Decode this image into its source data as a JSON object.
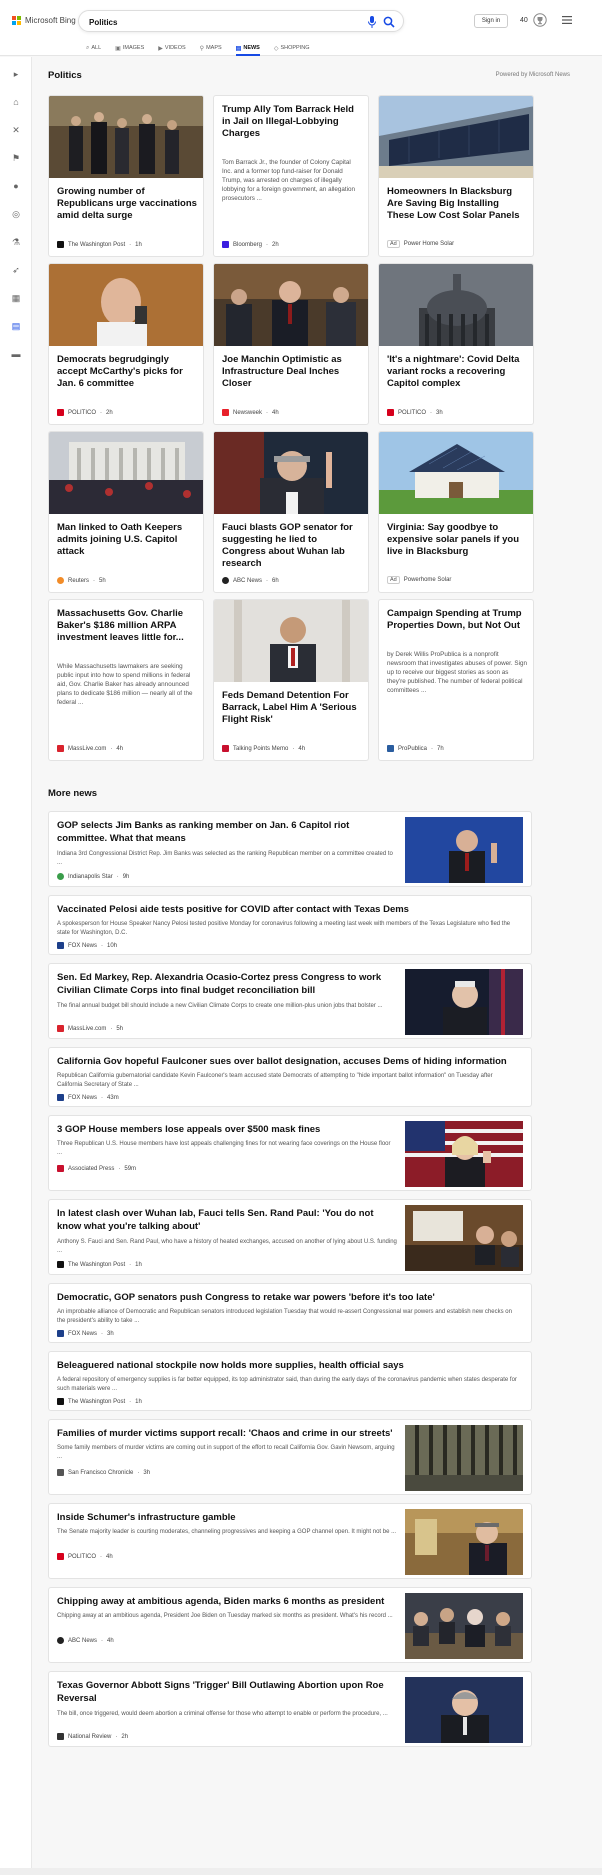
{
  "header": {
    "logo_text": "Microsoft Bing",
    "search_value": "Politics",
    "signin_label": "Sign in",
    "rewards_count": "40",
    "accent": "#174ae4"
  },
  "tabs": [
    {
      "label": "ALL",
      "icon": "search-icon"
    },
    {
      "label": "IMAGES",
      "icon": "image-icon"
    },
    {
      "label": "VIDEOS",
      "icon": "video-icon"
    },
    {
      "label": "MAPS",
      "icon": "map-pin-icon"
    },
    {
      "label": "NEWS",
      "icon": "news-icon",
      "active": true
    },
    {
      "label": "SHOPPING",
      "icon": "tag-icon"
    }
  ],
  "rail_icons": [
    "expand-icon",
    "home-icon",
    "tools-icon",
    "flag-icon",
    "location-icon",
    "globe-icon",
    "science-icon",
    "rocket-icon",
    "video-icon",
    "news-icon",
    "card-icon"
  ],
  "section": {
    "title": "Politics",
    "powered_by": "Powered by Microsoft News"
  },
  "cards": [
    {
      "title": "Growing number of Republicans urge vaccinations amid delta surge",
      "source": "The Washington Post",
      "time": "1h",
      "favicon_color": "#111"
    },
    {
      "title": "Trump Ally Tom Barrack Held in Jail on Illegal-Lobbying Charges",
      "snippet": "Tom Barrack Jr., the founder of Colony Capital Inc. and a former top fund-raiser for Donald Trump, was arrested on charges of illegally lobbying for a foreign government, an allegation prosecutors ...",
      "source": "Bloomberg",
      "time": "2h",
      "favicon_color": "#3b1ee0"
    },
    {
      "title": "Homeowners In Blacksburg Are Saving Big Installing These Low Cost Solar Panels",
      "source": "Power Home Solar",
      "ad": "Ad"
    },
    {
      "title": "Democrats begrudgingly accept McCarthy's picks for Jan. 6 committee",
      "source": "POLITICO",
      "time": "2h",
      "favicon_color": "#d6001c"
    },
    {
      "title": "Joe Manchin Optimistic as Infrastructure Deal Inches Closer",
      "source": "Newsweek",
      "time": "4h",
      "favicon_color": "#e8202a"
    },
    {
      "title": "'It's a nightmare': Covid Delta variant rocks a recovering Capitol complex",
      "source": "POLITICO",
      "time": "3h",
      "favicon_color": "#d6001c"
    },
    {
      "title": "Man linked to Oath Keepers admits joining U.S. Capitol attack",
      "source": "Reuters",
      "time": "5h",
      "favicon_color": "#f28c28"
    },
    {
      "title": "Fauci blasts GOP senator for suggesting he lied to Congress about Wuhan lab research",
      "source": "ABC News",
      "time": "6h",
      "favicon_color": "#222"
    },
    {
      "title": "Virginia: Say goodbye to expensive solar panels if you live in Blacksburg",
      "source": "Powerhome Solar",
      "ad": "Ad"
    },
    {
      "title": "Massachusetts Gov. Charlie Baker's $186 million ARPA investment leaves little for...",
      "snippet": "While Massachusetts lawmakers are seeking public input into how to spend millions in federal aid, Gov. Charlie Baker has already announced plans to dedicate $186 million — nearly all of the federal ...",
      "source": "MassLive.com",
      "time": "4h",
      "favicon_color": "#d9232d"
    },
    {
      "title": "Feds Demand Detention For Barrack, Label Him A 'Serious Flight Risk'",
      "source": "Talking Points Memo",
      "time": "4h",
      "favicon_color": "#c8102e"
    },
    {
      "title": "Campaign Spending at Trump Properties Down, but Not Out",
      "snippet": "by Derek Willis ProPublica is a nonprofit newsroom that investigates abuses of power. Sign up to receive our biggest stories as soon as they're published. The number of federal political committees ...",
      "source": "ProPublica",
      "time": "7h",
      "favicon_color": "#2a5d9f"
    }
  ],
  "more_news": {
    "title": "More news",
    "items": [
      {
        "title": "GOP selects Jim Banks as ranking member on Jan. 6 Capitol riot committee. What that means",
        "snippet": "Indiana 3rd Congressional District Rep. Jim Banks was selected as the ranking Republican member on a committee created to ...",
        "source": "Indianapolis Star",
        "time": "9h",
        "favicon_color": "#3a9d4a"
      },
      {
        "title": "Vaccinated Pelosi aide tests positive for COVID after contact with Texas Dems",
        "snippet": "A spokesperson for House Speaker Nancy Pelosi tested positive Monday for coronavirus following a meeting last week with members of the Texas Legislature who fled the state for Washington, D.C.",
        "source": "FOX News",
        "time": "10h",
        "favicon_color": "#1d3f8a"
      },
      {
        "title": "Sen. Ed Markey, Rep. Alexandria Ocasio-Cortez press Congress to work Civilian Climate Corps into final budget reconciliation bill",
        "snippet": "The final annual budget bill should include a new Civilian Climate Corps to create one million-plus union jobs that bolster ...",
        "source": "MassLive.com",
        "time": "5h",
        "favicon_color": "#d9232d"
      },
      {
        "title": "California Gov hopeful Faulconer sues over ballot designation, accuses Dems of hiding information",
        "snippet": "Republican California gubernatorial candidate Kevin Faulconer's team accused state Democrats of attempting to \"hide important ballot information\" on Tuesday after California Secretary of State ...",
        "source": "FOX News",
        "time": "43m",
        "favicon_color": "#1d3f8a"
      },
      {
        "title": "3 GOP House members lose appeals over $500 mask fines",
        "snippet": "Three Republican U.S. House members have lost appeals challenging fines for not wearing face coverings on the House floor ...",
        "source": "Associated Press",
        "time": "59m",
        "favicon_color": "#c8102e"
      },
      {
        "title": "In latest clash over Wuhan lab, Fauci tells Sen. Rand Paul: 'You do not know what you're talking about'",
        "snippet": "Anthony S. Fauci and Sen. Rand Paul, who have a history of heated exchanges, accused on another of lying about U.S. funding ...",
        "source": "The Washington Post",
        "time": "1h",
        "favicon_color": "#111"
      },
      {
        "title": "Democratic, GOP senators push Congress to retake war powers 'before it's too late'",
        "snippet": "An improbable alliance of Democratic and Republican senators introduced legislation Tuesday that would re-assert Congressional war powers and establish new checks on the president's ability to take ...",
        "source": "FOX News",
        "time": "3h",
        "favicon_color": "#1d3f8a"
      },
      {
        "title": "Beleaguered national stockpile now holds more supplies, health official says",
        "snippet": "A federal repository of emergency supplies is far better equipped, its top administrator said, than during the early days of the coronavirus pandemic when states desperate for such materials were ...",
        "source": "The Washington Post",
        "time": "1h",
        "favicon_color": "#111"
      },
      {
        "title": "Families of murder victims support recall: 'Chaos and crime in our streets'",
        "snippet": "Some family members of murder victims are coming out in support of the effort to recall California Gov. Gavin Newsom, arguing ...",
        "source": "San Francisco Chronicle",
        "time": "3h",
        "favicon_color": "#555"
      },
      {
        "title": "Inside Schumer's infrastructure gamble",
        "snippet": "The Senate majority leader is courting moderates, channeling progressives and keeping a GOP channel open. It might not be ...",
        "source": "POLITICO",
        "time": "4h",
        "favicon_color": "#d6001c"
      },
      {
        "title": "Chipping away at ambitious agenda, Biden marks 6 months as president",
        "snippet": "Chipping away at an ambitious agenda, President Joe Biden on Tuesday marked six months as president. What's his record ...",
        "source": "ABC News",
        "time": "4h",
        "favicon_color": "#222"
      },
      {
        "title": "Texas Governor Abbott Signs 'Trigger' Bill Outlawing Abortion upon Roe Reversal",
        "snippet": "The bill, once triggered, would deem abortion a criminal offense for those who attempt to enable or perform the procedure, ...",
        "source": "National Review",
        "time": "2h",
        "favicon_color": "#333"
      }
    ]
  }
}
